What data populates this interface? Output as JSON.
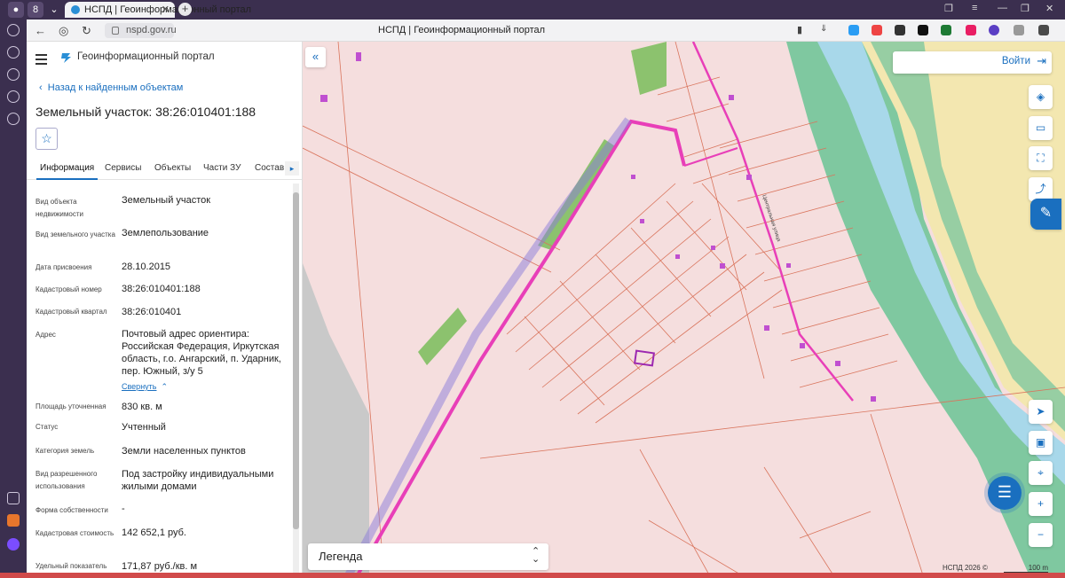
{
  "browser": {
    "tab_count": "8",
    "tab_title": "НСПД | Геоинформационный портал",
    "url": "nspd.gov.ru",
    "page_title": "НСПД | Геоинформационный портал"
  },
  "sidebar": {
    "portal_title": "Геоинформационный портал",
    "back_label": "Назад к найденным объектам",
    "title": "Земельный участок: 38:26:010401:188",
    "tabs": [
      "Информация",
      "Сервисы",
      "Объекты",
      "Части ЗУ",
      "Состав"
    ],
    "collapse_label": "Свернуть",
    "fields": [
      {
        "label": "Вид объекта недвижимости",
        "value": "Земельный участок"
      },
      {
        "label": "Вид земельного участка",
        "value": "Землепользование"
      },
      {
        "label": "Дата присвоения",
        "value": "28.10.2015"
      },
      {
        "label": "Кадастровый номер",
        "value": "38:26:010401:188"
      },
      {
        "label": "Кадастровый квартал",
        "value": "38:26:010401"
      },
      {
        "label": "Адрес",
        "value": "Почтовый адрес ориентира: Российская Федерация, Иркутская область, г.о. Ангарский, п. Ударник, пер. Южный, з/у 5"
      },
      {
        "label": "Площадь уточненная",
        "value": "830 кв. м"
      },
      {
        "label": "Статус",
        "value": "Учтенный"
      },
      {
        "label": "Категория земель",
        "value": "Земли населенных пунктов"
      },
      {
        "label": "Вид разрешенного использования",
        "value": "Под застройку индивидуальными жилыми домами"
      },
      {
        "label": "Форма собственности",
        "value": "-"
      },
      {
        "label": "Кадастровая стоимость",
        "value": "142 652,1 руб."
      },
      {
        "label": "Удельный показатель",
        "value": "171,87 руб./кв. м"
      }
    ]
  },
  "map": {
    "login_label": "Войти",
    "legend_label": "Легенда",
    "copyright": "НСПД 2026 ©",
    "scale_label": "100 m",
    "street_label": "Центральная улица"
  },
  "colors": {
    "accent": "#1a6fbf",
    "land_fill": "#f5dede",
    "parcel_line": "#d9745c",
    "river": "#a8d8ea",
    "forest": "#7fc8a0",
    "road": "#e83fb8"
  }
}
